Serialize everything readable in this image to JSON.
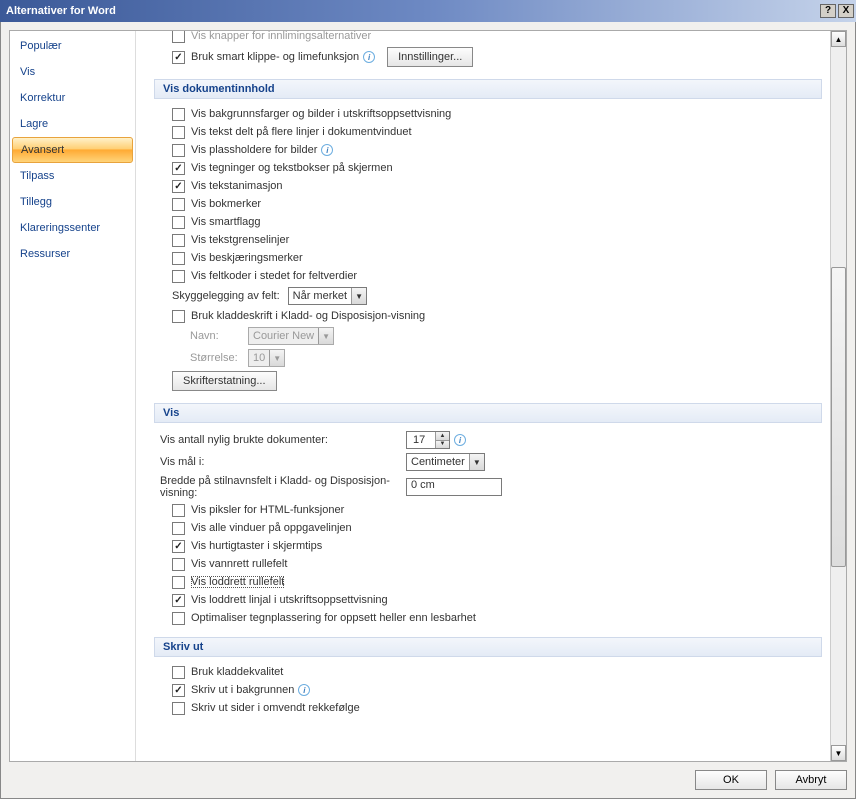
{
  "window": {
    "title": "Alternativer for Word",
    "help": "?",
    "close": "X"
  },
  "sidebar": {
    "items": [
      {
        "label": "Populær"
      },
      {
        "label": "Vis"
      },
      {
        "label": "Korrektur"
      },
      {
        "label": "Lagre"
      },
      {
        "label": "Avansert",
        "active": true
      },
      {
        "label": "Tilpass"
      },
      {
        "label": "Tillegg"
      },
      {
        "label": "Klareringssenter"
      },
      {
        "label": "Ressurser"
      }
    ]
  },
  "top_cut": {
    "chk_paste_options": "Vis knapper for innlimingsalternativer",
    "chk_smart_cut": "Bruk smart klippe- og limefunksjon",
    "btn_settings": "Innstillinger..."
  },
  "sec_doc": {
    "title": "Vis dokumentinnhold",
    "chk_bg_colors": "Vis bakgrunnsfarger og bilder i utskriftsoppsettvisning",
    "chk_wrap_text": "Vis tekst delt på flere linjer i dokumentvinduet",
    "chk_placeholders": "Vis plassholdere for bilder",
    "chk_drawings": "Vis tegninger og tekstbokser på skjermen",
    "chk_anim": "Vis tekstanimasjon",
    "chk_bookmarks": "Vis bokmerker",
    "chk_smarttags": "Vis smartflagg",
    "chk_text_bound": "Vis tekstgrenselinjer",
    "chk_crop": "Vis beskjæringsmerker",
    "chk_fieldcodes": "Vis feltkoder i stedet for feltverdier",
    "lbl_shading": "Skyggelegging av felt:",
    "val_shading": "Når merket",
    "chk_draft_font": "Bruk kladdeskrift i Kladd- og Disposisjon-visning",
    "lbl_name": "Navn:",
    "val_name": "Courier New",
    "lbl_size": "Størrelse:",
    "val_size": "10",
    "btn_font_sub": "Skrifterstatning..."
  },
  "sec_view": {
    "title": "Vis",
    "lbl_recent": "Vis antall nylig brukte dokumenter:",
    "val_recent": "17",
    "lbl_units": "Vis mål i:",
    "val_units": "Centimeter",
    "lbl_style_width": "Bredde på stilnavnsfelt i Kladd- og Disposisjon-visning:",
    "val_style_width": "0 cm",
    "chk_html_px": "Vis piksler for HTML-funksjoner",
    "chk_taskbar": "Vis alle vinduer på oppgavelinjen",
    "chk_shortcuts": "Vis hurtigtaster i skjermtips",
    "chk_hscroll": "Vis vannrett rullefelt",
    "chk_vscroll": "Vis loddrett rullefelt",
    "chk_vruler": "Vis loddrett linjal i utskriftsoppsettvisning",
    "chk_optimize": "Optimaliser tegnplassering for oppsett heller enn lesbarhet"
  },
  "sec_print": {
    "title": "Skriv ut",
    "chk_draft_quality": "Bruk kladdekvalitet",
    "chk_background": "Skriv ut i bakgrunnen",
    "chk_reverse": "Skriv ut sider i omvendt rekkefølge"
  },
  "buttons": {
    "ok": "OK",
    "cancel": "Avbryt"
  }
}
